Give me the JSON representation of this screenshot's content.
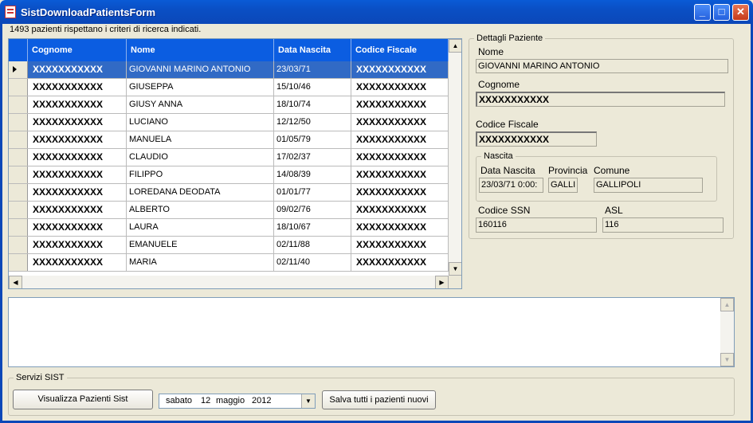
{
  "window": {
    "title": "SistDownloadPatientsForm",
    "min": "_",
    "max": "□",
    "close": "✕"
  },
  "status": {
    "count_text": "1493 pazienti rispettano i criteri di ricerca indicati."
  },
  "grid": {
    "columns": [
      "Cognome",
      "Nome",
      "Data Nascita",
      "Codice Fiscale"
    ],
    "rows": [
      [
        "XXXXXXXXXXX",
        "GIOVANNI MARINO ANTONIO",
        "23/03/71",
        "XXXXXXXXXXX"
      ],
      [
        "XXXXXXXXXXX",
        "GIUSEPPA",
        "15/10/46",
        "XXXXXXXXXXX"
      ],
      [
        "XXXXXXXXXXX",
        "GIUSY ANNA",
        "18/10/74",
        "XXXXXXXXXXX"
      ],
      [
        "XXXXXXXXXXX",
        "LUCIANO",
        "12/12/50",
        "XXXXXXXXXXX"
      ],
      [
        "XXXXXXXXXXX",
        "MANUELA",
        "01/05/79",
        "XXXXXXXXXXX"
      ],
      [
        "XXXXXXXXXXX",
        "CLAUDIO",
        "17/02/37",
        "XXXXXXXXXXX"
      ],
      [
        "XXXXXXXXXXX",
        "FILIPPO",
        "14/08/39",
        "XXXXXXXXXXX"
      ],
      [
        "XXXXXXXXXXX",
        "LOREDANA DEODATA",
        "01/01/77",
        "XXXXXXXXXXX"
      ],
      [
        "XXXXXXXXXXX",
        "ALBERTO",
        "09/02/76",
        "XXXXXXXXXXX"
      ],
      [
        "XXXXXXXXXXX",
        "LAURA",
        "18/10/67",
        "XXXXXXXXXXX"
      ],
      [
        "XXXXXXXXXXX",
        "EMANUELE",
        "02/11/88",
        "XXXXXXXXXXX"
      ],
      [
        "XXXXXXXXXXX",
        "MARIA",
        "02/11/40",
        "XXXXXXXXXXX"
      ]
    ],
    "selected_row": 0
  },
  "details": {
    "legend": "Dettagli Paziente",
    "nome_label": "Nome",
    "nome_value": "GIOVANNI MARINO ANTONIO",
    "cognome_label": "Cognome",
    "cognome_value": "XXXXXXXXXXX",
    "cf_label": "Codice Fiscale",
    "cf_value": "XXXXXXXXXXX",
    "nascita": {
      "legend": "Nascita",
      "data_label": "Data Nascita",
      "data_value": "23/03/71 0:00:",
      "provincia_label": "Provincia",
      "provincia_value": "GALLI",
      "comune_label": "Comune",
      "comune_value": "GALLIPOLI"
    },
    "ssn_label": "Codice SSN",
    "ssn_value": "160116",
    "asl_label": "ASL",
    "asl_value": "116"
  },
  "servizi": {
    "legend": "Servizi SIST",
    "visualizza_button": "Visualizza Pazienti Sist",
    "date": {
      "day_name": "sabato",
      "day": "12",
      "month": "maggio",
      "year": "2012"
    },
    "salva_button": "Salva tutti i pazienti nuovi"
  },
  "colors": {
    "title_bar": "#0b4fc4",
    "header": "#0b5de1",
    "selection": "#316ac5"
  }
}
